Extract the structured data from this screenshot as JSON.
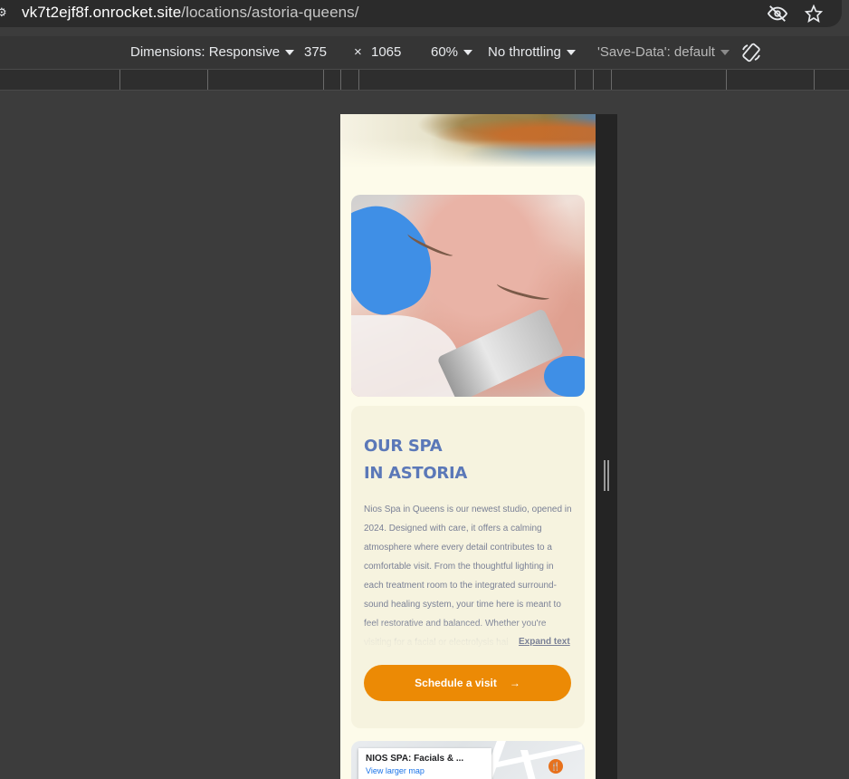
{
  "browser": {
    "url_host": "vk7t2ejf8f.onrocket.site",
    "url_path": "/locations/astoria-queens/"
  },
  "device_toolbar": {
    "dimensions_label": "Dimensions: Responsive",
    "width": "375",
    "times": "×",
    "height": "1065",
    "zoom": "60%",
    "throttling": "No throttling",
    "save_data": "'Save-Data': default"
  },
  "page": {
    "heading_line1": "OUR SPA",
    "heading_line2": "IN ASTORIA",
    "body": "Nios Spa in Queens is our newest studio, opened in 2024. Designed with care, it offers a calming atmosphere where every detail contributes to a comfortable visit. From the thoughtful lighting in each treatment room to the integrated surround-sound healing system, your time here is meant to feel restorative and balanced. Whether you're visiting for a facial or electrolysis hai",
    "expand_label": "Expand text",
    "cta_label": "Schedule a visit",
    "cta_arrow": "→",
    "map": {
      "place_name": "NIOS SPA: Facials & ...",
      "view_larger": "View larger map"
    }
  },
  "colors": {
    "heading": "#5b78b8",
    "cta": "#ec8a05",
    "page_bg": "#fdfbea",
    "card_bg": "#f6f3df"
  }
}
